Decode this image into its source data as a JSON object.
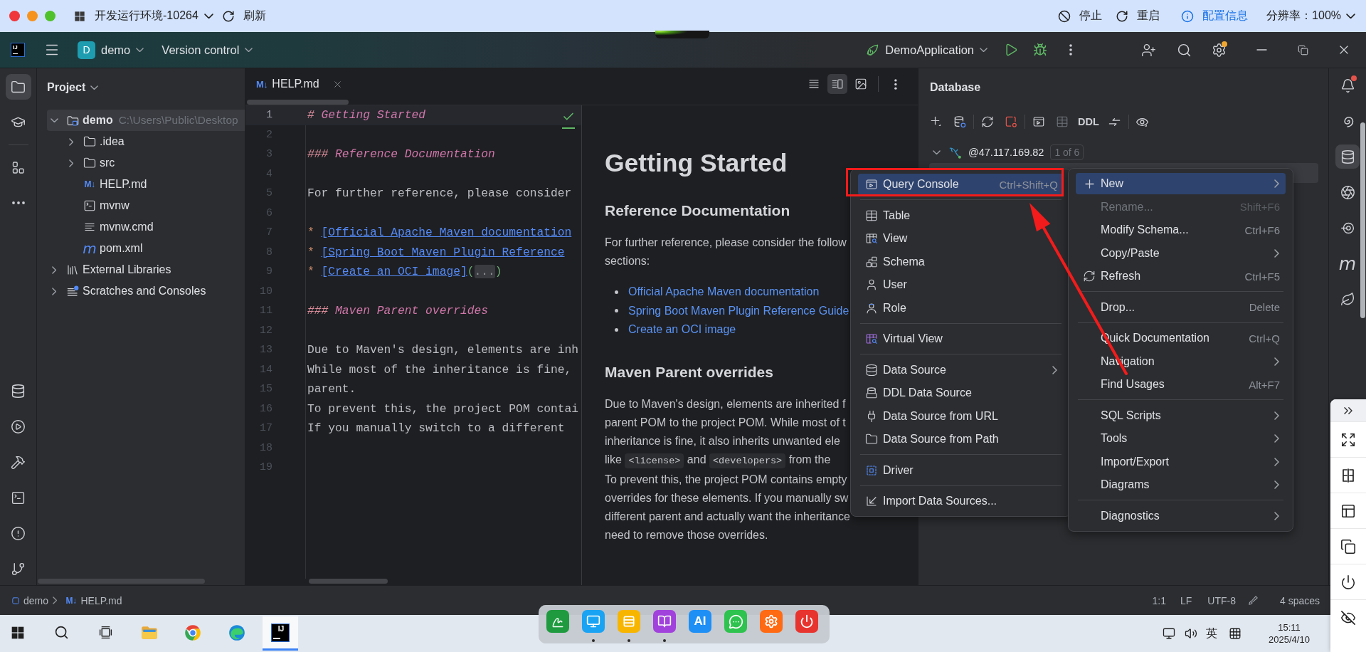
{
  "browser_bar": {
    "window_controls": [
      {
        "color": "#f0353b"
      },
      {
        "color": "#f6921e"
      },
      {
        "color": "#4fc12b"
      }
    ],
    "title": "开发运行环境-10264",
    "refresh": "刷新",
    "actions": [
      {
        "kind": "stop",
        "label": "停止"
      },
      {
        "kind": "restart",
        "label": "重启"
      },
      {
        "kind": "info",
        "label": "配置信息"
      }
    ],
    "resolution": "分辨率：100%"
  },
  "ide_header": {
    "logo": "IJ",
    "project_badge": "D",
    "project": "demo",
    "vcs": "Version control",
    "run_config": "DemoApplication",
    "settings_badge": true
  },
  "left_tools": {
    "top": [
      {
        "kind": "project",
        "selected": true
      },
      {
        "kind": "learn",
        "selected": false
      },
      {
        "kind": "structure",
        "selected": false
      },
      {
        "kind": "more",
        "selected": false
      }
    ],
    "bottom": [
      {
        "kind": "database",
        "selected": false
      },
      {
        "kind": "services",
        "selected": false
      },
      {
        "kind": "build",
        "selected": false
      },
      {
        "kind": "terminal",
        "selected": false
      },
      {
        "kind": "problems",
        "selected": false
      },
      {
        "kind": "git",
        "selected": false
      }
    ]
  },
  "project_panel": {
    "title": "Project",
    "tree": [
      {
        "kind": "module",
        "label": "demo",
        "path": "C:\\Users\\Public\\Desktop",
        "expanded": true,
        "selected": true,
        "children": [
          {
            "kind": "folder",
            "label": ".idea",
            "expanded": false,
            "selected": false
          },
          {
            "kind": "folder",
            "label": "src",
            "expanded": false,
            "selected": false
          },
          {
            "kind": "markdown",
            "glyph": "M↓",
            "label": "HELP.md",
            "selected": false
          },
          {
            "kind": "script",
            "label": "mvnw",
            "selected": false
          },
          {
            "kind": "text",
            "label": "mvnw.cmd",
            "selected": false
          },
          {
            "kind": "maven",
            "glyph": "m",
            "label": "pom.xml",
            "selected": false
          }
        ]
      },
      {
        "kind": "libraries",
        "label": "External Libraries",
        "expanded": false,
        "selected": false
      },
      {
        "kind": "scratches",
        "label": "Scratches and Consoles",
        "expanded": false,
        "selected": false
      }
    ]
  },
  "editor": {
    "tabs": [
      {
        "glyph": "M↓",
        "label": "HELP.md",
        "selected": true
      }
    ],
    "view_modes": [
      {
        "kind": "code",
        "selected": false
      },
      {
        "kind": "split",
        "selected": true
      },
      {
        "kind": "preview",
        "selected": false
      }
    ],
    "lines": [
      {
        "number": "1",
        "current": true,
        "parts": [
          {
            "kind": "marker",
            "text": "#"
          },
          {
            "kind": "heading",
            "text": "Getting Started"
          }
        ]
      },
      {
        "number": "2",
        "current": false
      },
      {
        "number": "3",
        "current": false,
        "parts": [
          {
            "kind": "marker",
            "text": "###"
          },
          {
            "kind": "heading",
            "text": "Reference Documentation"
          }
        ]
      },
      {
        "number": "4",
        "current": false
      },
      {
        "number": "5",
        "current": false,
        "parts": [
          {
            "kind": "plain",
            "text": "For further reference, please consider"
          }
        ]
      },
      {
        "number": "6",
        "current": false
      },
      {
        "number": "7",
        "current": false,
        "parts": [
          {
            "kind": "bullet",
            "text": "*"
          },
          {
            "kind": "link",
            "text": "[Official Apache Maven documentation"
          }
        ]
      },
      {
        "number": "8",
        "current": false,
        "parts": [
          {
            "kind": "bullet",
            "text": "*"
          },
          {
            "kind": "link",
            "text": "[Spring Boot Maven Plugin Reference"
          }
        ]
      },
      {
        "number": "9",
        "current": false,
        "parts": [
          {
            "kind": "bullet",
            "text": "*"
          },
          {
            "kind": "link",
            "text": "[Create an OCI image]"
          },
          {
            "kind": "paren",
            "text": "("
          },
          {
            "kind": "fold",
            "text": "..."
          },
          {
            "kind": "paren",
            "text": ")"
          }
        ]
      },
      {
        "number": "10",
        "current": false
      },
      {
        "number": "11",
        "current": false,
        "parts": [
          {
            "kind": "marker",
            "text": "###"
          },
          {
            "kind": "heading",
            "text": "Maven Parent overrides"
          }
        ]
      },
      {
        "number": "12",
        "current": false
      },
      {
        "number": "13",
        "current": false,
        "parts": [
          {
            "kind": "plain",
            "text": "Due to Maven's design, elements are inh"
          }
        ]
      },
      {
        "number": "14",
        "current": false,
        "parts": [
          {
            "kind": "plain",
            "text": "While most of the inheritance is fine,"
          }
        ]
      },
      {
        "number": "15",
        "current": false,
        "parts": [
          {
            "kind": "plain",
            "text": "parent."
          }
        ]
      },
      {
        "number": "16",
        "current": false,
        "parts": [
          {
            "kind": "plain",
            "text": "To prevent this, the project POM contai"
          }
        ]
      },
      {
        "number": "17",
        "current": false,
        "parts": [
          {
            "kind": "plain",
            "text": "If you manually switch to a different"
          }
        ]
      },
      {
        "number": "18",
        "current": false
      },
      {
        "number": "19",
        "current": false
      }
    ]
  },
  "preview": {
    "blocks": [
      {
        "kind": "h1",
        "text": "Getting Started"
      },
      {
        "kind": "h2",
        "text": "Reference Documentation"
      },
      {
        "kind": "paragraph",
        "lines": [
          [
            {
              "kind": "text",
              "text": "For further reference, please consider the follow"
            }
          ],
          [
            {
              "kind": "text",
              "text": "sections:"
            }
          ]
        ]
      },
      {
        "kind": "list",
        "items": [
          "Official Apache Maven documentation",
          "Spring Boot Maven Plugin Reference Guide",
          "Create an OCI image"
        ]
      },
      {
        "kind": "h2",
        "text": "Maven Parent overrides"
      },
      {
        "kind": "paragraph",
        "lines": [
          [
            {
              "kind": "text",
              "text": "Due to Maven's design, elements are inherited f"
            }
          ],
          [
            {
              "kind": "text",
              "text": "parent POM to the project POM. While most of t"
            }
          ],
          [
            {
              "kind": "text",
              "text": "inheritance is fine, it also inherits unwanted ele"
            }
          ],
          [
            {
              "kind": "text",
              "text": "like"
            },
            {
              "kind": "code",
              "text": "<license>"
            },
            {
              "kind": "text",
              "text": "and"
            },
            {
              "kind": "code",
              "text": "<developers>"
            },
            {
              "kind": "text",
              "text": "from the"
            }
          ],
          [
            {
              "kind": "text",
              "text": "To prevent this, the project POM contains empty"
            }
          ],
          [
            {
              "kind": "text",
              "text": "overrides for these elements. If you manually sw"
            }
          ],
          [
            {
              "kind": "text",
              "text": "different parent and actually want the inheritance"
            }
          ],
          [
            {
              "kind": "text",
              "text": "need to remove those overrides."
            }
          ]
        ]
      }
    ]
  },
  "database_panel": {
    "title": "Database",
    "ddl": "DDL",
    "tree": [
      {
        "label": "@47.117.169.82",
        "badge": "1 of 6",
        "expanded": true,
        "selected": false,
        "children": [
          {
            "selected": true
          }
        ]
      }
    ]
  },
  "context_menu": {
    "columns": [
      {
        "items": [
          {
            "kind": "item",
            "label": "Query Console",
            "shortcut": "Ctrl+Shift+Q",
            "selected": true,
            "disabled": false,
            "submenu": false
          },
          {
            "kind": "separator"
          },
          {
            "kind": "item",
            "label": "Table",
            "selected": false,
            "disabled": false,
            "submenu": false
          },
          {
            "kind": "item",
            "label": "View",
            "selected": false,
            "disabled": false,
            "submenu": false
          },
          {
            "kind": "item",
            "label": "Schema",
            "selected": false,
            "disabled": false,
            "submenu": false
          },
          {
            "kind": "item",
            "label": "User",
            "selected": false,
            "disabled": false,
            "submenu": false
          },
          {
            "kind": "item",
            "label": "Role",
            "selected": false,
            "disabled": false,
            "submenu": false
          },
          {
            "kind": "separator"
          },
          {
            "kind": "item",
            "label": "Virtual View",
            "selected": false,
            "disabled": false,
            "submenu": false
          },
          {
            "kind": "separator"
          },
          {
            "kind": "item",
            "label": "Data Source",
            "selected": false,
            "disabled": false,
            "submenu": true
          },
          {
            "kind": "item",
            "label": "DDL Data Source",
            "selected": false,
            "disabled": false,
            "submenu": false
          },
          {
            "kind": "item",
            "label": "Data Source from URL",
            "selected": false,
            "disabled": false,
            "submenu": false
          },
          {
            "kind": "item",
            "label": "Data Source from Path",
            "selected": false,
            "disabled": false,
            "submenu": false
          },
          {
            "kind": "separator"
          },
          {
            "kind": "item",
            "label": "Driver",
            "selected": false,
            "disabled": false,
            "submenu": false
          },
          {
            "kind": "separator"
          },
          {
            "kind": "item",
            "label": "Import Data Sources...",
            "selected": false,
            "disabled": false,
            "submenu": false
          }
        ]
      },
      {
        "items": [
          {
            "kind": "item",
            "label": "New",
            "selected": true,
            "disabled": false,
            "submenu": true
          },
          {
            "kind": "item",
            "label": "Rename...",
            "shortcut": "Shift+F6",
            "selected": false,
            "disabled": true,
            "submenu": false
          },
          {
            "kind": "item",
            "label": "Modify Schema...",
            "shortcut": "Ctrl+F6",
            "selected": false,
            "disabled": false,
            "submenu": false
          },
          {
            "kind": "item",
            "label": "Copy/Paste",
            "selected": false,
            "disabled": false,
            "submenu": true
          },
          {
            "kind": "item",
            "label": "Refresh",
            "shortcut": "Ctrl+F5",
            "selected": false,
            "disabled": false,
            "submenu": false
          },
          {
            "kind": "separator"
          },
          {
            "kind": "item",
            "label": "Drop...",
            "shortcut": "Delete",
            "selected": false,
            "disabled": false,
            "submenu": false
          },
          {
            "kind": "separator"
          },
          {
            "kind": "item",
            "label": "Quick Documentation",
            "shortcut": "Ctrl+Q",
            "selected": false,
            "disabled": false,
            "submenu": false
          },
          {
            "kind": "item",
            "label": "Navigation",
            "selected": false,
            "disabled": false,
            "submenu": true
          },
          {
            "kind": "item",
            "label": "Find Usages",
            "shortcut": "Alt+F7",
            "selected": false,
            "disabled": false,
            "submenu": false
          },
          {
            "kind": "separator"
          },
          {
            "kind": "item",
            "label": "SQL Scripts",
            "selected": false,
            "disabled": false,
            "submenu": true
          },
          {
            "kind": "item",
            "label": "Tools",
            "selected": false,
            "disabled": false,
            "submenu": true
          },
          {
            "kind": "item",
            "label": "Import/Export",
            "selected": false,
            "disabled": false,
            "submenu": true
          },
          {
            "kind": "item",
            "label": "Diagrams",
            "selected": false,
            "disabled": false,
            "submenu": true
          },
          {
            "kind": "separator"
          },
          {
            "kind": "item",
            "label": "Diagnostics",
            "selected": false,
            "disabled": false,
            "submenu": true
          }
        ]
      }
    ]
  },
  "right_tools": [
    {
      "kind": "notifications",
      "badge": true,
      "selected": false
    },
    {
      "kind": "ai",
      "selected": false
    },
    {
      "kind": "database",
      "selected": true
    },
    {
      "kind": "plugin",
      "selected": false
    },
    {
      "kind": "endpoints",
      "selected": false
    },
    {
      "kind": "maven",
      "glyph": "m",
      "selected": false
    },
    {
      "kind": "spring",
      "selected": false
    }
  ],
  "status_bar": {
    "breadcrumbs": [
      {
        "kind": "module",
        "label": "demo"
      },
      {
        "kind": "markdown",
        "glyph": "M↓",
        "label": "HELP.md"
      }
    ],
    "position": "1:1",
    "line_separator": "LF",
    "encoding": "UTF-8",
    "indent": "4 spaces"
  },
  "taskbar": {
    "apps": [
      {
        "kind": "start",
        "selected": false
      },
      {
        "kind": "search",
        "selected": false
      },
      {
        "kind": "task_view",
        "selected": false
      },
      {
        "kind": "files",
        "selected": false
      },
      {
        "kind": "browser",
        "selected": false
      },
      {
        "kind": "browser_alt",
        "selected": false
      },
      {
        "kind": "ide",
        "glyph": "IJ",
        "selected": true
      }
    ],
    "dock": [
      {
        "color": "#1f9a3f",
        "running": false
      },
      {
        "color": "#1aa3f2",
        "running": true
      },
      {
        "color": "#f7b500",
        "running": true
      },
      {
        "color": "#a142dc",
        "running": true
      },
      {
        "color": "#1e8ff5",
        "label": "AI",
        "running": false
      },
      {
        "color": "#2ec24e",
        "running": false
      },
      {
        "color": "#ff6a13",
        "running": false
      },
      {
        "color": "#e8342e",
        "running": false
      }
    ],
    "language": "英",
    "time": "15:11",
    "date": "2025/4/10"
  }
}
